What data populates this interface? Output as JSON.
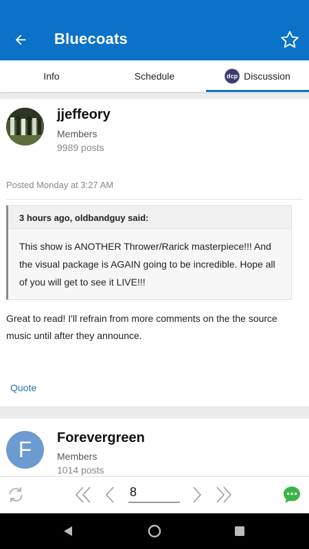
{
  "header": {
    "title": "Bluecoats"
  },
  "tabs": [
    {
      "label": "Info"
    },
    {
      "label": "Schedule"
    },
    {
      "label": "Discussion",
      "badge": "dcp"
    }
  ],
  "posts": [
    {
      "username": "jjeffeory",
      "role": "Members",
      "post_count": "9989 posts",
      "posted": "Posted Monday at 3:27 AM",
      "quote": {
        "header": "3 hours ago, oldbandguy said:",
        "body": "This show is ANOTHER Thrower/Rarick masterpiece!!! And the visual package is AGAIN going to be incredible. Hope all of you will get to see it LIVE!!!"
      },
      "text": "Great to read! I'll refrain from more comments on the the source music until after they announce.",
      "quote_label": "Quote"
    },
    {
      "avatar_letter": "F",
      "username": "Forevergreen",
      "role": "Members",
      "post_count": "1014 posts"
    }
  ],
  "pagination": {
    "current_page": "8"
  },
  "colors": {
    "brand": "#0b72c7",
    "link": "#2d6fb5",
    "chat": "#3db24a"
  }
}
